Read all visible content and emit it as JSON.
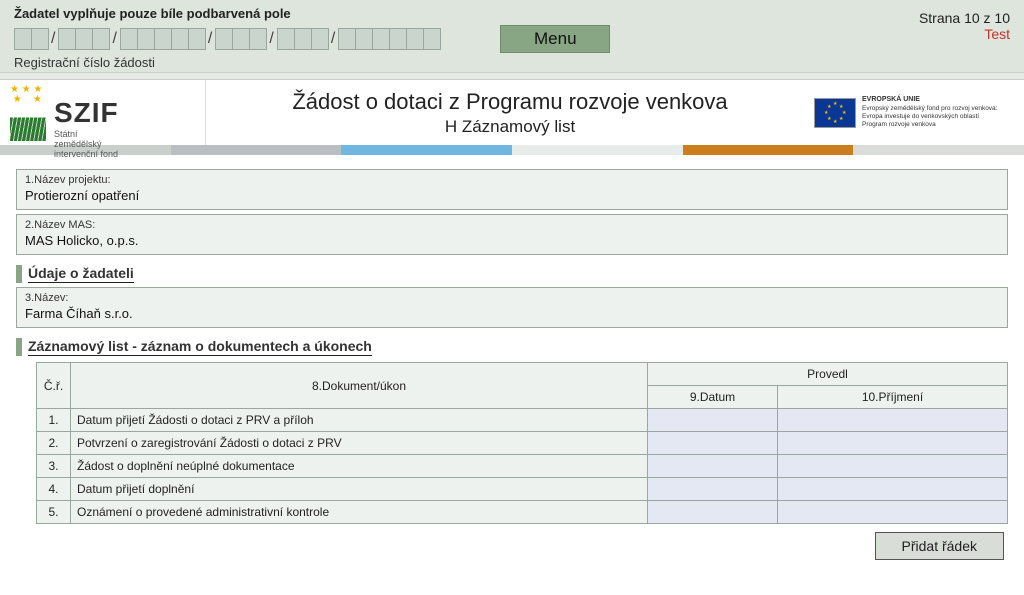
{
  "header": {
    "instruction": "Žadatel vyplňuje pouze bíle podbarvená pole",
    "reg_label": "Registrační číslo žádosti",
    "menu_label": "Menu",
    "page_label": "Strana 10 z 10",
    "test_label": "Test"
  },
  "logo": {
    "szif": "SZIF",
    "szif_sub": "Státní zemědělský intervenční fond"
  },
  "title": {
    "main": "Žádost o dotaci z Programu rozvoje venkova",
    "sub": "H Záznamový list"
  },
  "eu": {
    "l1": "EVROPSKÁ UNIE",
    "l2": "Evropský zemědělský fond pro rozvoj venkova:",
    "l3": "Evropa investuje do venkovských oblastí",
    "l4": "Program rozvoje venkova"
  },
  "fields": {
    "f1_label": "1.Název projektu:",
    "f1_value": "Protierozní opatření",
    "f2_label": "2.Název MAS:",
    "f2_value": "MAS Holicko, o.p.s.",
    "f3_label": "3.Název:",
    "f3_value": "Farma Číhaň s.r.o."
  },
  "sections": {
    "s1": "Údaje o žadateli",
    "s2": "Záznamový list - záznam o dokumentech a úkonech"
  },
  "table": {
    "h_cr": "Č.ř.",
    "h_doc": "8.Dokument/úkon",
    "h_group": "Provedl",
    "h_date": "9.Datum",
    "h_name": "10.Příjmení",
    "rows": [
      {
        "n": "1.",
        "doc": "Datum přijetí Žádosti o dotaci z PRV a příloh",
        "date": "",
        "name": ""
      },
      {
        "n": "2.",
        "doc": "Potvrzení o zaregistrování Žádosti o dotaci z PRV",
        "date": "",
        "name": ""
      },
      {
        "n": "3.",
        "doc": "Žádost o doplnění neúplné dokumentace",
        "date": "",
        "name": ""
      },
      {
        "n": "4.",
        "doc": "Datum přijetí doplnění",
        "date": "",
        "name": ""
      },
      {
        "n": "5.",
        "doc": "Oznámení o provedené administrativní kontrole",
        "date": "",
        "name": ""
      }
    ]
  },
  "buttons": {
    "add_row": "Přidat řádek"
  }
}
